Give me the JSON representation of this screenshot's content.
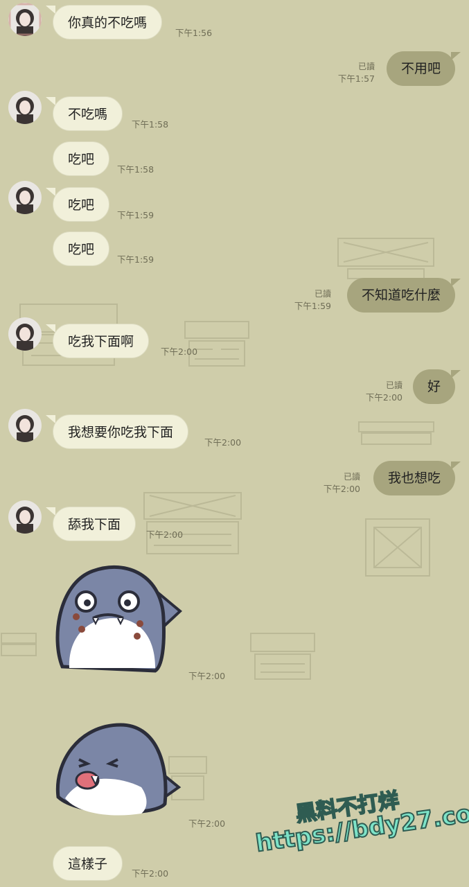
{
  "messages": [
    {
      "id": "m1",
      "dir": "in",
      "text": "你真的不吃嗎",
      "time": "下午1:56"
    },
    {
      "id": "m2",
      "dir": "out",
      "text": "不用吧",
      "time": "下午1:57",
      "read": "已讀"
    },
    {
      "id": "m3",
      "dir": "in",
      "text": "不吃嗎",
      "time": "下午1:58"
    },
    {
      "id": "m4",
      "dir": "in",
      "text": "吃吧",
      "time": "下午1:58"
    },
    {
      "id": "m5",
      "dir": "in",
      "text": "吃吧",
      "time": "下午1:59"
    },
    {
      "id": "m6",
      "dir": "in",
      "text": "吃吧",
      "time": "下午1:59"
    },
    {
      "id": "m7",
      "dir": "out",
      "text": "不知道吃什麼",
      "time": "下午1:59",
      "read": "已讀"
    },
    {
      "id": "m8",
      "dir": "in",
      "text": "吃我下面啊",
      "time": "下午2:00"
    },
    {
      "id": "m9",
      "dir": "out",
      "text": "好",
      "time": "下午2:00",
      "read": "已讀"
    },
    {
      "id": "m10",
      "dir": "in",
      "text": "我想要你吃我下面",
      "time": "下午2:00"
    },
    {
      "id": "m11",
      "dir": "out",
      "text": "我也想吃",
      "time": "下午2:00",
      "read": "已讀"
    },
    {
      "id": "m12",
      "dir": "in",
      "text": "舔我下面",
      "time": "下午2:00"
    },
    {
      "id": "s1",
      "dir": "in",
      "sticker": "shark-worried-sticker",
      "time": "下午2:00"
    },
    {
      "id": "s2",
      "dir": "in",
      "sticker": "shark-tongue-sticker",
      "time": "下午2:00"
    },
    {
      "id": "m13",
      "dir": "in",
      "text": "這樣子",
      "time": "下午2:00"
    }
  ],
  "watermark": {
    "line1": "黑料不打烊",
    "line2": "https://bdy27.co"
  },
  "colors": {
    "background": "#cfcdaa",
    "incoming_bubble": "#f1f0da",
    "outgoing_bubble": "#a7a57e"
  }
}
